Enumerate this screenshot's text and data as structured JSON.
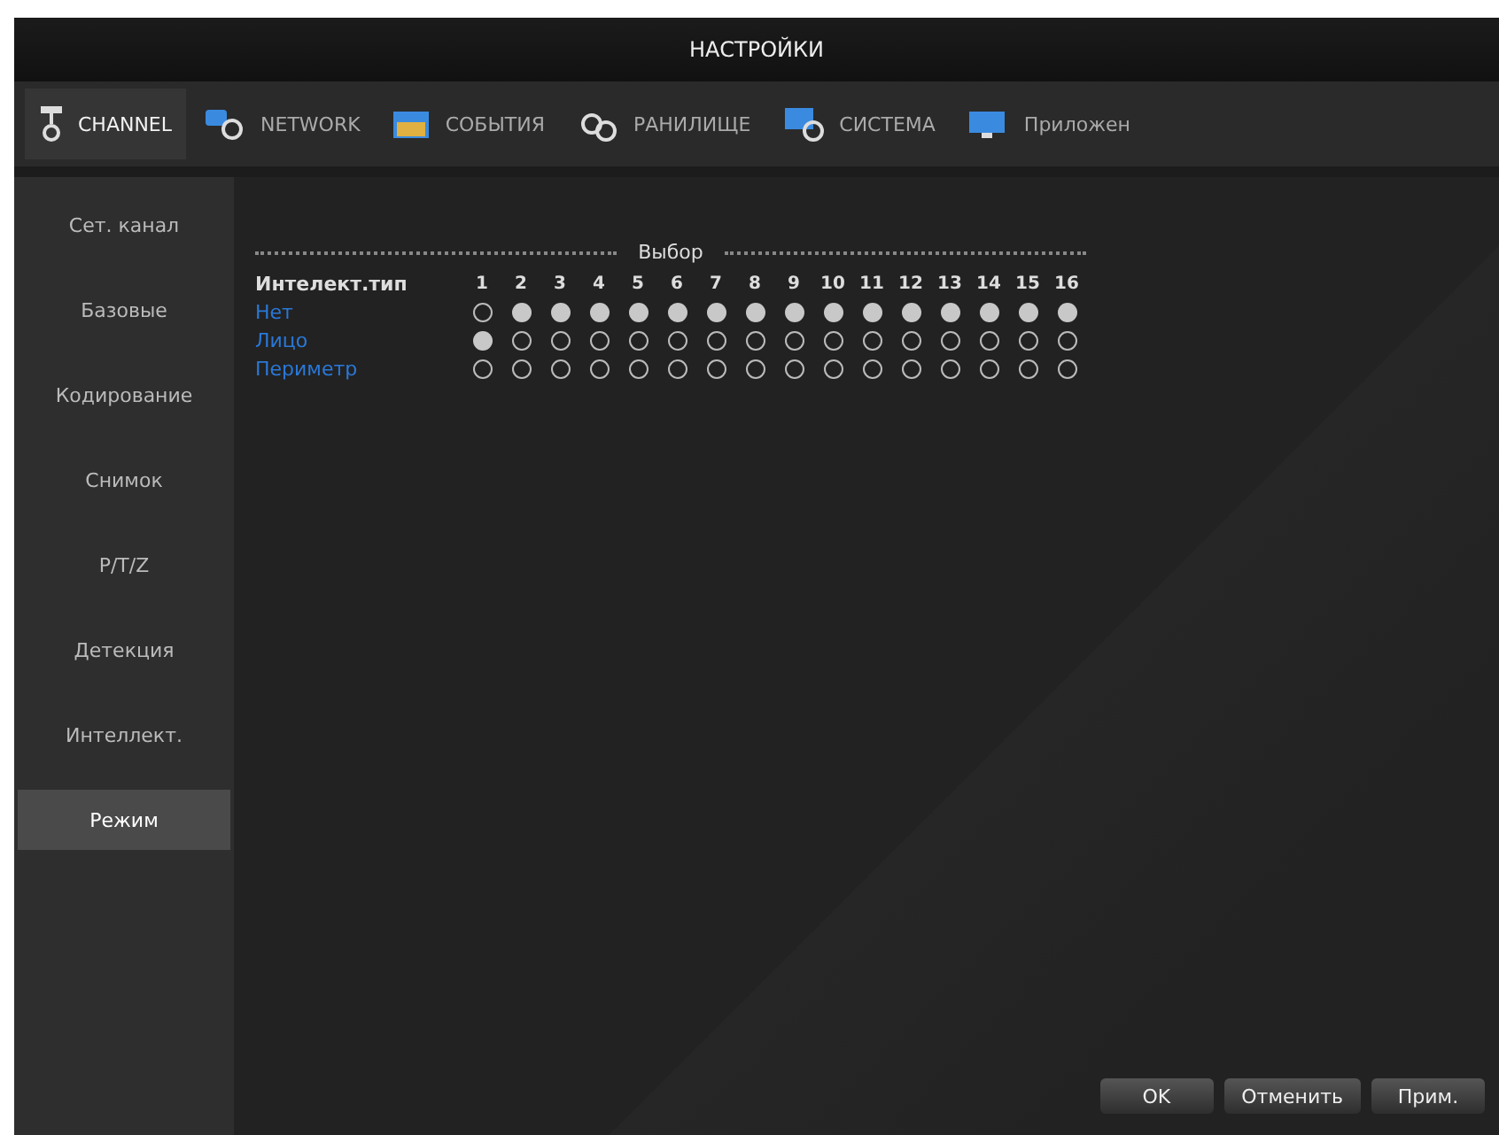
{
  "window": {
    "title": "НАСТРОЙКИ"
  },
  "tabs": [
    {
      "label": "CHANNEL",
      "selected": true,
      "kind": "camera"
    },
    {
      "label": "NETWORK",
      "selected": false,
      "kind": "network"
    },
    {
      "label": "СОБЫТИЯ",
      "selected": false,
      "kind": "events"
    },
    {
      "label": "РАНИЛИЩЕ",
      "selected": false,
      "kind": "storage"
    },
    {
      "label": "СИСТЕМА",
      "selected": false,
      "kind": "system"
    },
    {
      "label": "Приложен",
      "selected": false,
      "kind": "apps"
    }
  ],
  "sidebar": {
    "items": [
      {
        "label": "Сет. канал",
        "selected": false
      },
      {
        "label": "Базовые",
        "selected": false
      },
      {
        "label": "Кодирование",
        "selected": false
      },
      {
        "label": "Снимок",
        "selected": false
      },
      {
        "label": "P/T/Z",
        "selected": false
      },
      {
        "label": "Детекция",
        "selected": false
      },
      {
        "label": "Интеллект.",
        "selected": false
      },
      {
        "label": "Режим",
        "selected": true
      }
    ]
  },
  "matrix": {
    "section_title": "Выбор",
    "header_label": "Интелект.тип",
    "columns": [
      "1",
      "2",
      "3",
      "4",
      "5",
      "6",
      "7",
      "8",
      "9",
      "10",
      "11",
      "12",
      "13",
      "14",
      "15",
      "16"
    ],
    "rows": [
      {
        "label": "Нет",
        "cells": [
          {
            "selected": false
          },
          {
            "selected": true
          },
          {
            "selected": true
          },
          {
            "selected": true
          },
          {
            "selected": true
          },
          {
            "selected": true
          },
          {
            "selected": true
          },
          {
            "selected": true
          },
          {
            "selected": true
          },
          {
            "selected": true
          },
          {
            "selected": true
          },
          {
            "selected": true
          },
          {
            "selected": true
          },
          {
            "selected": true
          },
          {
            "selected": true
          },
          {
            "selected": true
          }
        ]
      },
      {
        "label": "Лицо",
        "cells": [
          {
            "selected": true
          },
          {
            "selected": false
          },
          {
            "selected": false
          },
          {
            "selected": false
          },
          {
            "selected": false
          },
          {
            "selected": false
          },
          {
            "selected": false
          },
          {
            "selected": false
          },
          {
            "selected": false
          },
          {
            "selected": false
          },
          {
            "selected": false
          },
          {
            "selected": false
          },
          {
            "selected": false
          },
          {
            "selected": false
          },
          {
            "selected": false
          },
          {
            "selected": false
          }
        ]
      },
      {
        "label": "Периметр",
        "cells": [
          {
            "selected": false
          },
          {
            "selected": false
          },
          {
            "selected": false
          },
          {
            "selected": false
          },
          {
            "selected": false
          },
          {
            "selected": false
          },
          {
            "selected": false
          },
          {
            "selected": false
          },
          {
            "selected": false
          },
          {
            "selected": false
          },
          {
            "selected": false
          },
          {
            "selected": false
          },
          {
            "selected": false
          },
          {
            "selected": false
          },
          {
            "selected": false
          },
          {
            "selected": false
          }
        ]
      }
    ]
  },
  "buttons": [
    "OK",
    "Отменить",
    "Прим."
  ]
}
